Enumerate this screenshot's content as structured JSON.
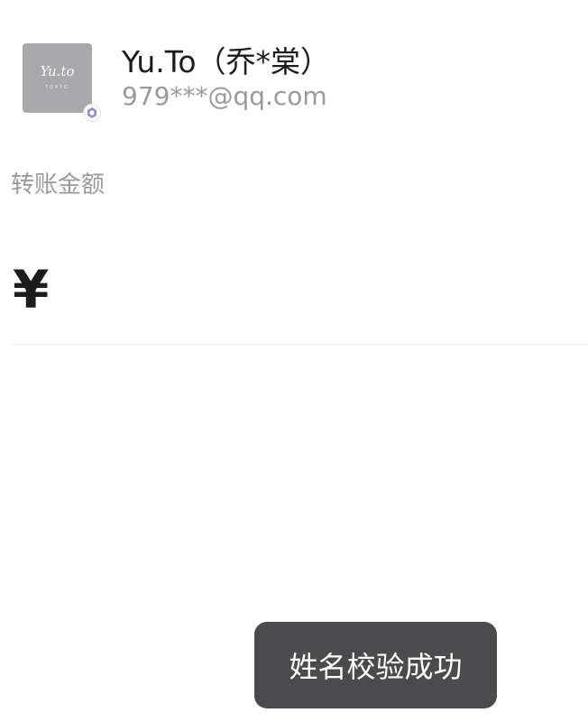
{
  "recipient": {
    "avatar_logo_text": "Yu.to",
    "avatar_logo_subtext": "TOKYO",
    "name": "Yu.To（乔*棠）",
    "account": "979***@qq.com",
    "verified_icon": "verified-badge-icon"
  },
  "transfer": {
    "amount_label": "转账金额",
    "currency_symbol": "¥",
    "amount_value": ""
  },
  "toast": {
    "message": "姓名校验成功"
  },
  "colors": {
    "background": "#ffffff",
    "primary_text": "#1c1c1e",
    "secondary_text": "#9a9a9c",
    "avatar_bg": "#a9a9ac",
    "toast_bg": "#4b4b4d",
    "verified_accent": "#8e93c9"
  }
}
